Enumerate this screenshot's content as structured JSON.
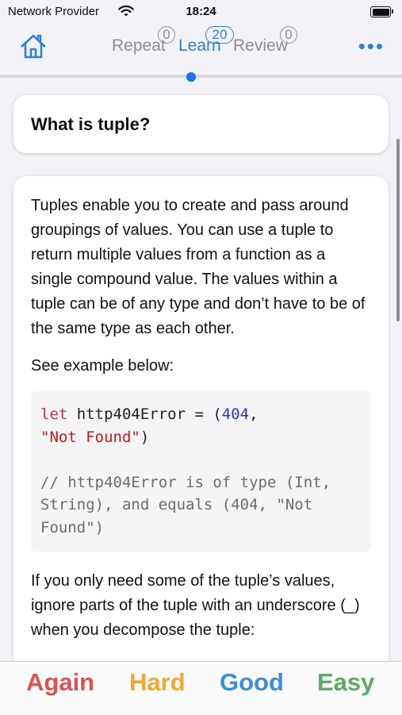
{
  "status_bar": {
    "carrier": "Network Provider",
    "time": "18:24"
  },
  "nav": {
    "tabs": [
      {
        "label": "Repeat",
        "count": "0"
      },
      {
        "label": "Learn",
        "count": "20"
      },
      {
        "label": "Review",
        "count": "0"
      }
    ],
    "active_tab": "Learn",
    "more_label": "•••"
  },
  "card": {
    "question": "What is tuple?",
    "intro": "Tuples enable you to create and pass around groupings of values. You can use a tuple to return multiple values from a function as a single compound value. The values within a tuple can be of any type and don’t have to be of the same type as each other.",
    "see_example": "See example below:",
    "code": {
      "keyword": "let",
      "decl": " http404Error = (",
      "number": "404",
      "comma": ",",
      "string": "\"Not Found\"",
      "close": ")",
      "comment": "// http404Error is of type (Int, String), and equals (404, \"Not Found\")"
    },
    "outro": "If you only need some of the tuple’s values, ignore parts of the tuple with an underscore (_) when you decompose the tuple:"
  },
  "answers": {
    "again": "Again",
    "hard": "Hard",
    "good": "Good",
    "easy": "Easy"
  },
  "colors": {
    "accent": "#2f7fe0",
    "again": "#d9534f",
    "hard": "#f0a833",
    "good": "#3c8fd6",
    "easy": "#5cab66"
  }
}
